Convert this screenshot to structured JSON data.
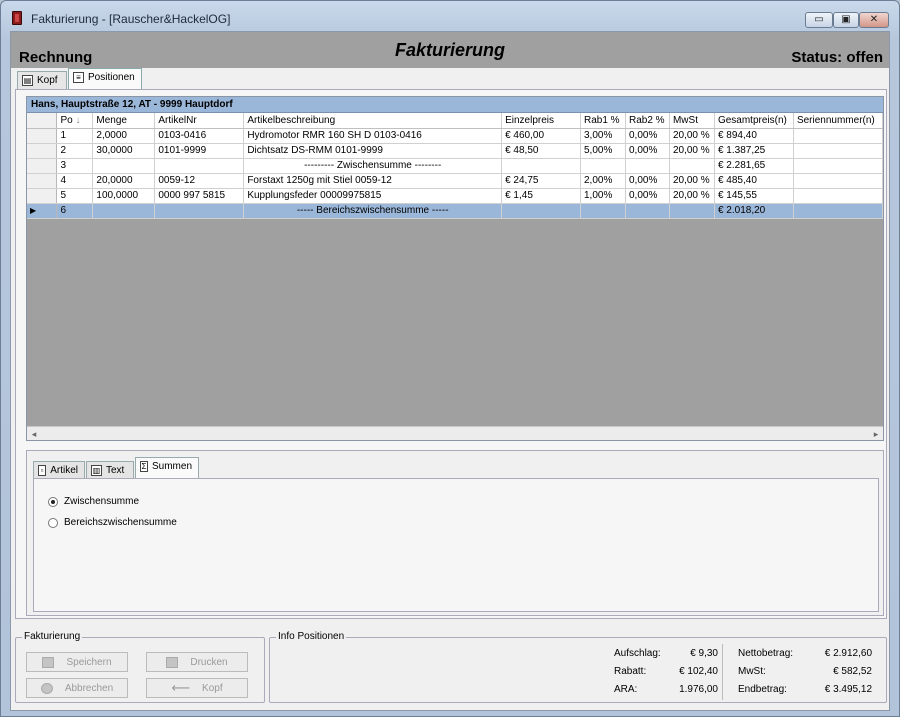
{
  "window": {
    "title": "Fakturierung - [Rauscher&HackelOG]",
    "minimize_glyph": "▭",
    "maximize_glyph": "▣",
    "close_glyph": "✕"
  },
  "header": {
    "left": "Rechnung",
    "center": "Fakturierung",
    "right": "Status: offen"
  },
  "tabs": [
    {
      "label": "Kopf",
      "icon": "header-form-icon"
    },
    {
      "label": "Positionen",
      "icon": "document-icon"
    }
  ],
  "grid": {
    "caption": "Hans, Hauptstraße 12, AT - 9999 Hauptdorf",
    "columns": [
      "Po",
      "Menge",
      "ArtikelNr",
      "Artikelbeschreibung",
      "Einzelpreis",
      "Rab1 %",
      "Rab2 %",
      "MwSt",
      "Gesamtpreis(n)",
      "Seriennummer(n)"
    ],
    "sort_indicator": "↓",
    "current_row_marker": "▶",
    "rows": [
      [
        "1",
        "2,0000",
        "0103-0416",
        "Hydromotor RMR 160 SH D 0103-0416",
        "€ 460,00",
        "3,00%",
        "0,00%",
        "20,00 %",
        "€ 894,40",
        ""
      ],
      [
        "2",
        "30,0000",
        "0101-9999",
        "Dichtsatz DS-RMM 0101-9999",
        "€ 48,50",
        "5,00%",
        "0,00%",
        "20,00 %",
        "€ 1.387,25",
        ""
      ],
      [
        "3",
        "",
        "",
        "--------- Zwischensumme --------",
        "",
        "",
        "",
        "",
        "€ 2.281,65",
        ""
      ],
      [
        "4",
        "20,0000",
        "0059-12",
        "Forstaxt 1250g mit Stiel 0059-12",
        "€ 24,75",
        "2,00%",
        "0,00%",
        "20,00 %",
        "€ 485,40",
        ""
      ],
      [
        "5",
        "100,0000",
        "0000 997 5815",
        "Kupplungsfeder 00009975815",
        "€ 1,45",
        "1,00%",
        "0,00%",
        "20,00 %",
        "€ 145,55",
        ""
      ],
      [
        "6",
        "",
        "",
        "----- Bereichszwischensumme -----",
        "",
        "",
        "",
        "",
        "€ 2.018,20",
        ""
      ]
    ],
    "selected_row_index": 5,
    "scroll_left": "◂",
    "scroll_right": "▸"
  },
  "subtabs": [
    {
      "label": "Artikel",
      "icon": "article-icon"
    },
    {
      "label": "Text",
      "icon": "text-icon"
    },
    {
      "label": "Summen",
      "icon": "sum-icon"
    }
  ],
  "summen": {
    "options": [
      "Zwischensumme",
      "Bereichszwischensumme"
    ],
    "selected": 0
  },
  "fakturierung_group": {
    "title": "Fakturierung",
    "buttons": {
      "save": "Speichern",
      "print": "Drucken",
      "cancel": "Abbrechen",
      "back": "Kopf"
    }
  },
  "info": {
    "title": "Info Positionen",
    "left": [
      {
        "label": "Aufschlag:",
        "value": "€ 9,30"
      },
      {
        "label": "Rabatt:",
        "value": "€ 102,40"
      },
      {
        "label": "ARA:",
        "value": "1.976,00"
      }
    ],
    "right": [
      {
        "label": "Nettobetrag:",
        "value": "€ 2.912,60"
      },
      {
        "label": "MwSt:",
        "value": "€ 582,52"
      },
      {
        "label": "Endbetrag:",
        "value": "€ 3.495,12"
      }
    ]
  }
}
